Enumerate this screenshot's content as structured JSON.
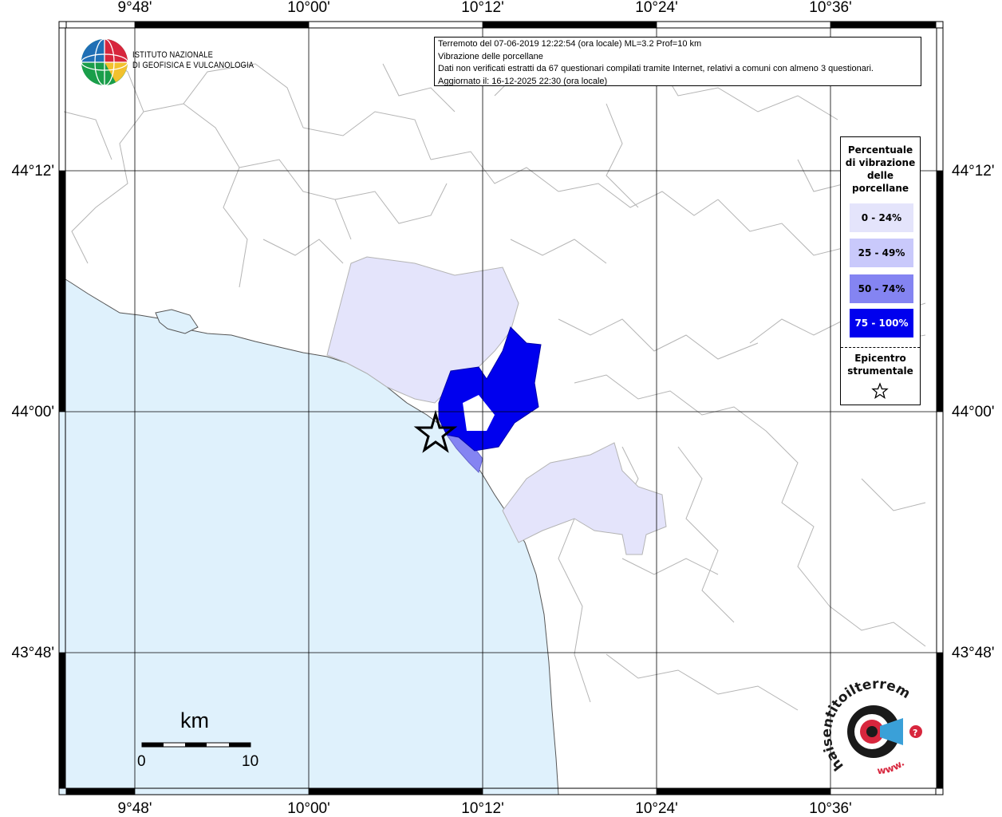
{
  "map": {
    "title_lines": [
      "Terremoto del 07-06-2019 12:22:54 (ora locale) ML=3.2 Prof=10 km",
      "Vibrazione delle porcellane",
      "Dati non verificati estratti da 67 questionari compilati tramite Internet, relativi a comuni con almeno 3 questionari.",
      "Aggiornato il: 16-12-2025 22:30 (ora locale)"
    ],
    "longitude_ticks": [
      "9°48'",
      "10°00'",
      "10°12'",
      "10°24'",
      "10°36'"
    ],
    "latitude_ticks": [
      "44°12'",
      "44°00'",
      "43°48'"
    ],
    "colors": {
      "sea": "#dff1fc",
      "land": "#ffffff",
      "border": "#b4b4b4",
      "grid": "#000000",
      "class_0_24": "#e4e4fb",
      "class_25_49": "#c9c9fb",
      "class_50_74": "#8484f2",
      "class_75_100": "#0000ee"
    }
  },
  "logo": {
    "line1": "ISTITUTO NAZIONALE",
    "line2": "DI GEOFISICA E VULCANOLOGIA"
  },
  "legend": {
    "title_lines": [
      "Percentuale",
      "di vibrazione",
      "delle",
      "porcellane"
    ],
    "classes": [
      {
        "label": "0 - 24%",
        "color": "#e4e4fb"
      },
      {
        "label": "25 - 49%",
        "color": "#c9c9fb"
      },
      {
        "label": "50 - 74%",
        "color": "#8484f2"
      },
      {
        "label": "75 - 100%",
        "color": "#0000ee"
      }
    ],
    "epicenter_lines": [
      "Epicentro",
      "strumentale"
    ]
  },
  "scale": {
    "unit": "km",
    "min": "0",
    "max": "10"
  },
  "brand": {
    "text": "haisentitoilterremoto.it",
    "url_text": "www."
  }
}
